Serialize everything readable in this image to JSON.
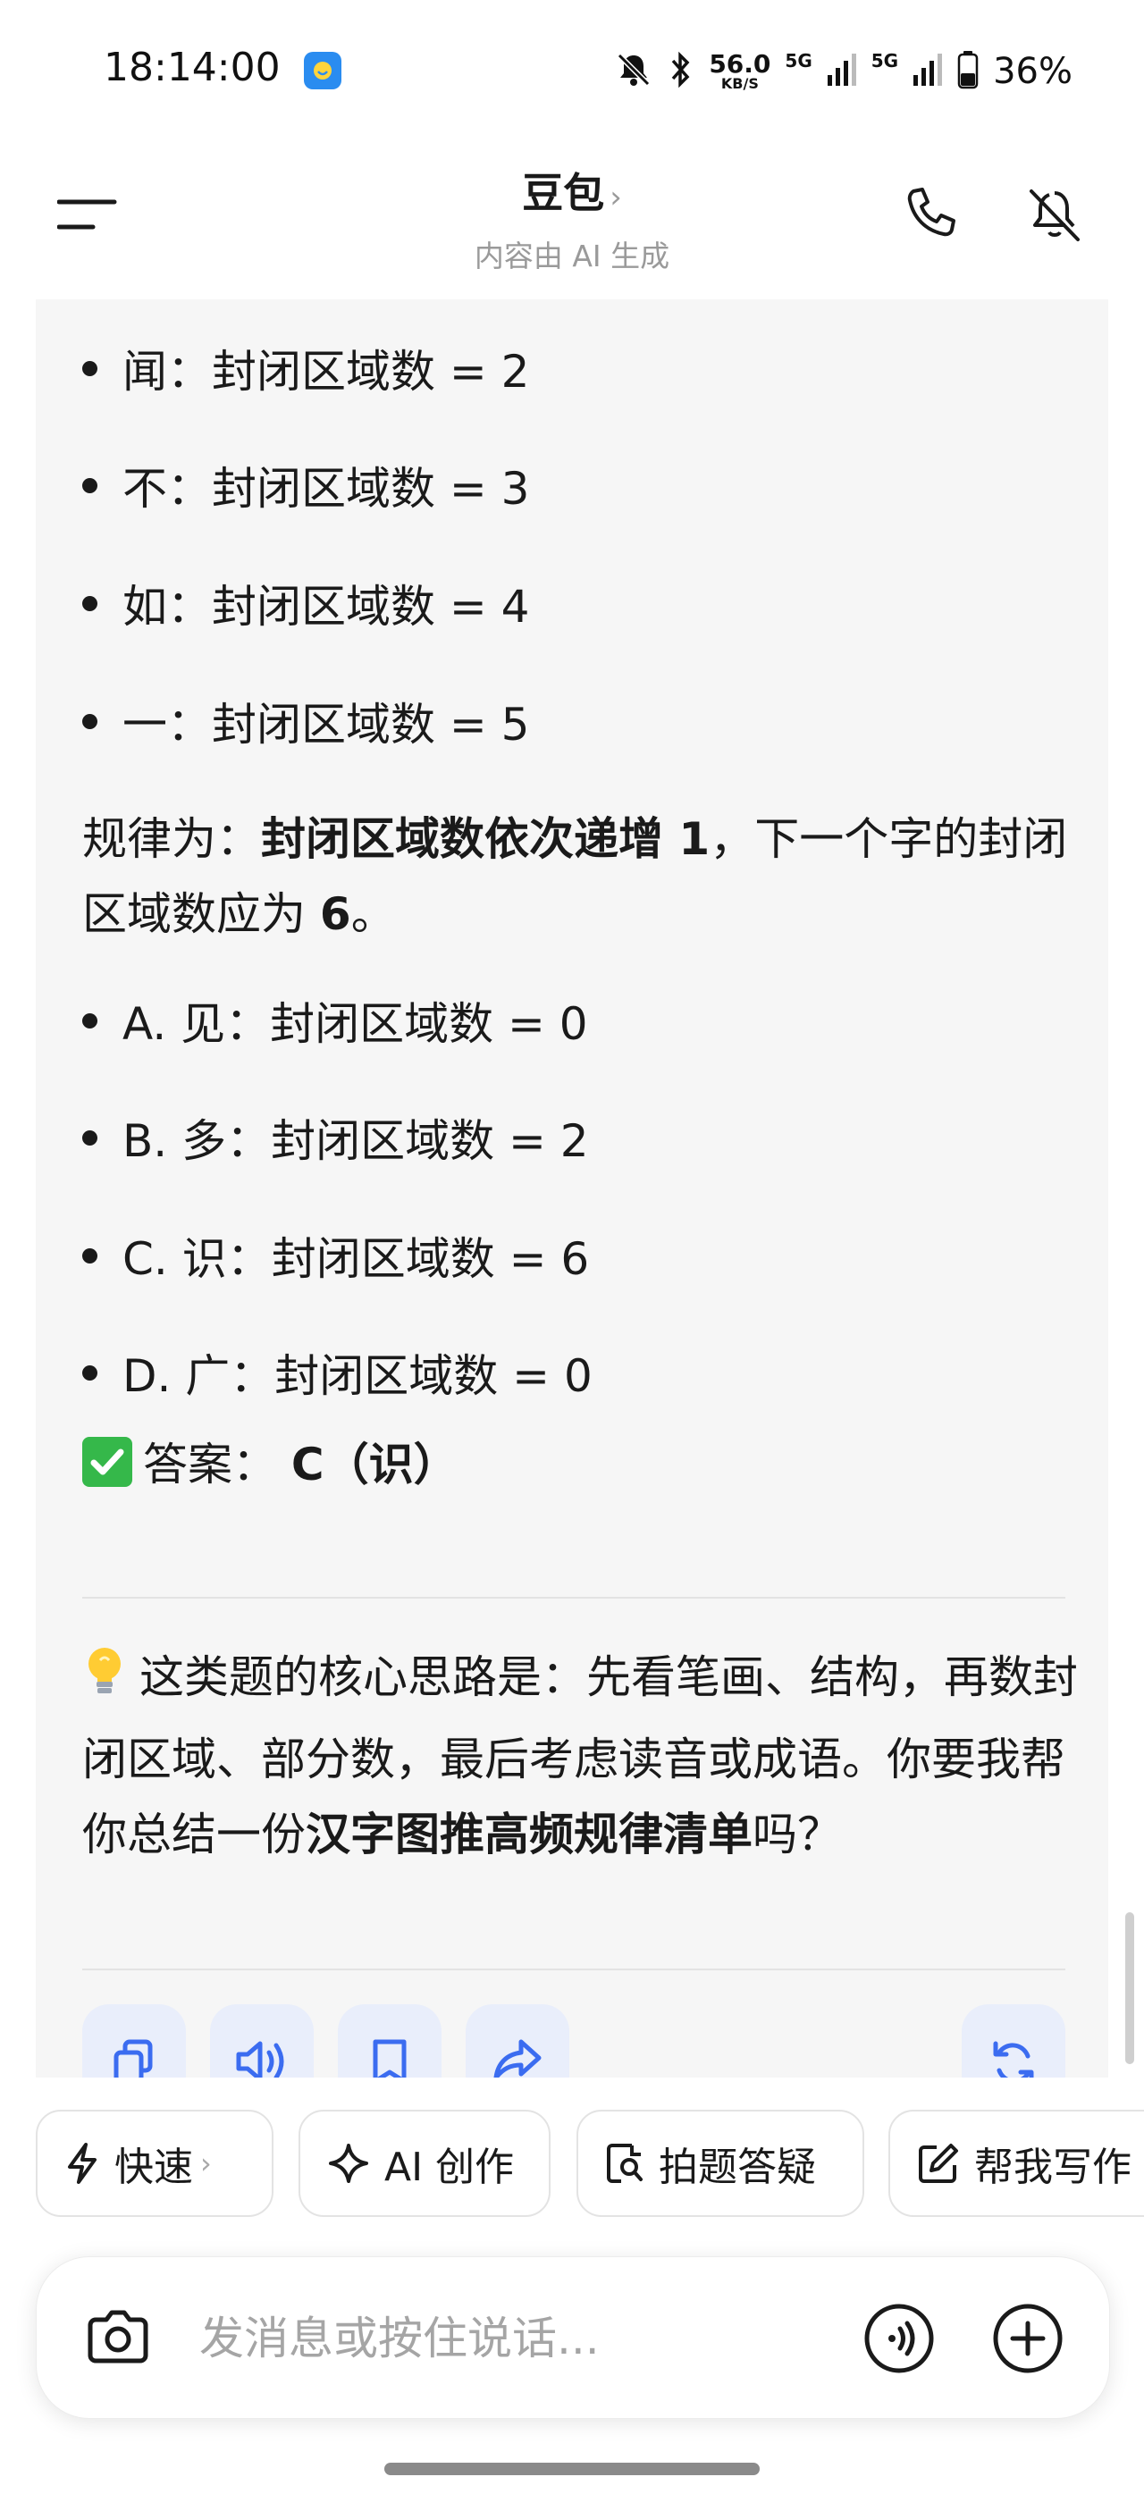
{
  "status_bar": {
    "time": "18:14:00",
    "net_speed": "56.0",
    "net_unit": "KB/S",
    "net_5g_1": "5G",
    "net_5g_2": "5G",
    "battery": "36%"
  },
  "header": {
    "title": "豆包",
    "title_chevron": "›",
    "subtitle": "内容由 AI 生成"
  },
  "message": {
    "bullets_top": [
      "闻：封闭区域数 = 2",
      "不：封闭区域数 = 3",
      "如：封闭区域数 = 4",
      "一：封闭区域数 = 5"
    ],
    "rule": {
      "prefix": "规律为：",
      "bold1": "封闭区域数依次递增",
      "bold1_num": " 1",
      "mid": "，下一个字的封闭区域数应为 ",
      "bold2": "6",
      "suffix": "。"
    },
    "options": [
      "A. 见：封闭区域数 = 0",
      "B. 多：封闭区域数 = 2",
      "C. 识：封闭区域数 = 6",
      "D. 广：封闭区域数 = 0"
    ],
    "answer": {
      "label": "答案：",
      "value": "C（识）"
    },
    "tip": {
      "part1": "这类题的核心思路是：先看笔画、结构，再数封闭区域、部分数，最后考虑读音或成语。你要我帮你总结一份",
      "bold": "汉字图推高频规律清单",
      "part2": "吗？"
    }
  },
  "chips": [
    {
      "label": "快速",
      "icon": "lightning-icon"
    },
    {
      "label": "AI 创作",
      "icon": "sparkle-icon"
    },
    {
      "label": "拍题答疑",
      "icon": "photo-search-icon"
    },
    {
      "label": "帮我写作",
      "icon": "edit-icon"
    }
  ],
  "input": {
    "placeholder": "发消息或按住说话..."
  },
  "colors": {
    "card_bg": "#f6f6f6",
    "action_btn_bg": "#e9eefb",
    "action_icon": "#3b6cf0",
    "check_green": "#35b84a"
  }
}
